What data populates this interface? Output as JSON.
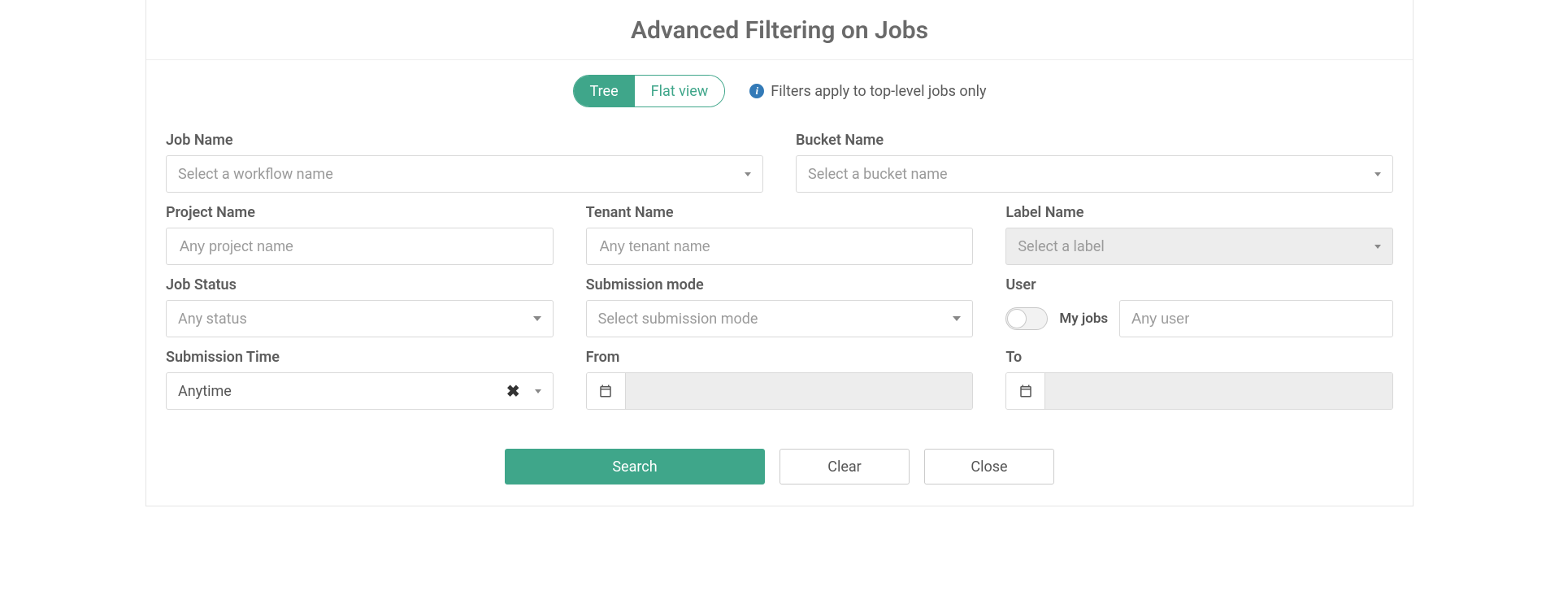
{
  "title": "Advanced Filtering on Jobs",
  "viewToggle": {
    "tree": "Tree",
    "flat": "Flat view"
  },
  "infoNote": "Filters apply to top-level jobs only",
  "fields": {
    "jobName": {
      "label": "Job Name",
      "placeholder": "Select a workflow name"
    },
    "bucketName": {
      "label": "Bucket Name",
      "placeholder": "Select a bucket name"
    },
    "projectName": {
      "label": "Project Name",
      "placeholder": "Any project name"
    },
    "tenantName": {
      "label": "Tenant Name",
      "placeholder": "Any tenant name"
    },
    "labelName": {
      "label": "Label Name",
      "placeholder": "Select a label"
    },
    "jobStatus": {
      "label": "Job Status",
      "placeholder": "Any status"
    },
    "submissionMode": {
      "label": "Submission mode",
      "placeholder": "Select submission mode"
    },
    "user": {
      "label": "User",
      "toggleLabel": "My jobs",
      "placeholder": "Any user"
    },
    "submissionTime": {
      "label": "Submission Time",
      "value": "Anytime"
    },
    "from": {
      "label": "From"
    },
    "to": {
      "label": "To"
    }
  },
  "buttons": {
    "search": "Search",
    "clear": "Clear",
    "close": "Close"
  }
}
